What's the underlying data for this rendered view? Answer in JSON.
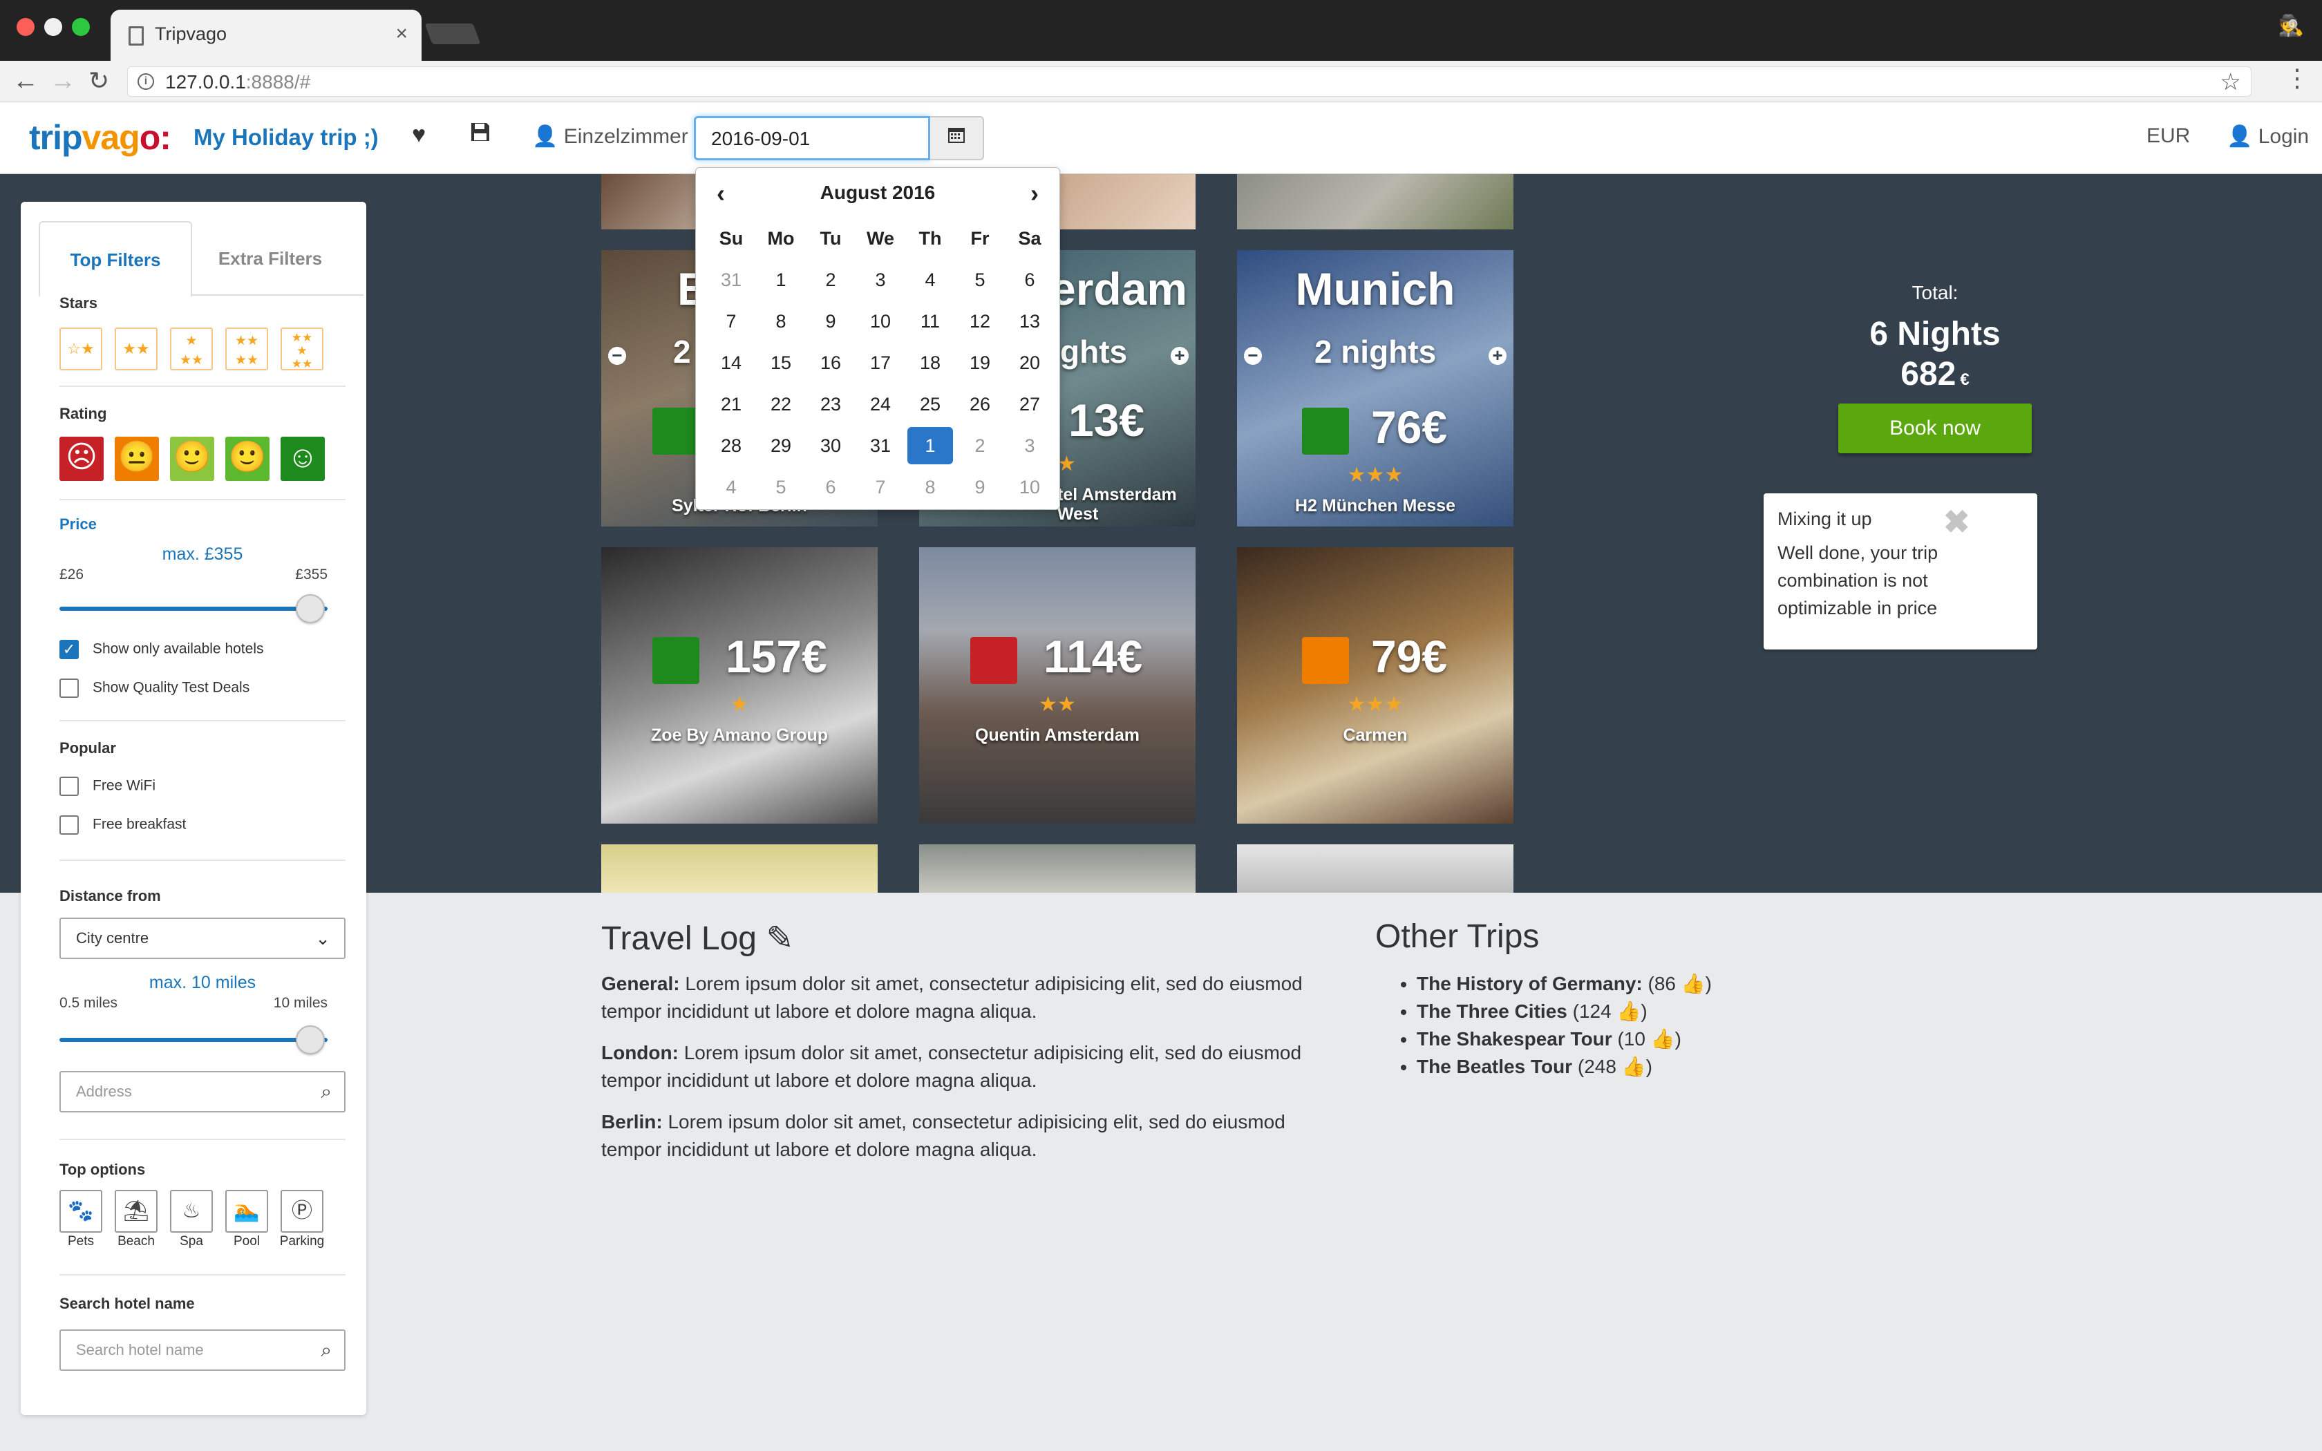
{
  "browser": {
    "tab_title": "Tripvago",
    "url_host": "127.0.0.1",
    "url_rest": ":8888/#"
  },
  "header": {
    "logo_part1": "trip",
    "logo_part2": "vag",
    "logo_part3": "o:",
    "trip_name": "My Holiday trip ;)",
    "room_type": "Einzelzimmer",
    "date_value": "2016-09-01",
    "currency": "EUR",
    "login": "Login"
  },
  "calendar": {
    "month_title": "August 2016",
    "weekdays": [
      "Su",
      "Mo",
      "Tu",
      "We",
      "Th",
      "Fr",
      "Sa"
    ],
    "weeks": [
      [
        "31",
        "1",
        "2",
        "3",
        "4",
        "5",
        "6"
      ],
      [
        "7",
        "8",
        "9",
        "10",
        "11",
        "12",
        "13"
      ],
      [
        "14",
        "15",
        "16",
        "17",
        "18",
        "19",
        "20"
      ],
      [
        "21",
        "22",
        "23",
        "24",
        "25",
        "26",
        "27"
      ],
      [
        "28",
        "29",
        "30",
        "31",
        "1",
        "2",
        "3"
      ],
      [
        "4",
        "5",
        "6",
        "7",
        "8",
        "9",
        "10"
      ]
    ],
    "selected_day": "1"
  },
  "sidebar": {
    "tab_top": "Top Filters",
    "tab_extra": "Extra Filters",
    "stars_label": "Stars",
    "rating_label": "Rating",
    "price_label": "Price",
    "price_max": "max. £355",
    "price_min_label": "£26",
    "price_max_label": "£355",
    "price_slider_value": 1.0,
    "show_available": "Show only available hotels",
    "show_quality": "Show Quality Test Deals",
    "popular_label": "Popular",
    "free_wifi": "Free WiFi",
    "free_breakfast": "Free breakfast",
    "distance_label": "Distance from",
    "distance_select": "City centre",
    "distance_max": "max. 10 miles",
    "distance_min_label": "0.5 miles",
    "distance_max_label": "10 miles",
    "distance_slider_value": 1.0,
    "address_placeholder": "Address",
    "top_options_label": "Top options",
    "options": [
      "Pets",
      "Beach",
      "Spa",
      "Pool",
      "Parking"
    ],
    "search_label": "Search hotel name",
    "search_placeholder": "Search hotel name"
  },
  "tiles": {
    "berlin_city": "B",
    "berlin_nights": "2",
    "berlin_name": "Sylter Hof Berlin",
    "amsterdam_city": "erdam",
    "amsterdam_nights": "ghts",
    "amsterdam_price": "13€",
    "amsterdam_name": "tel Amsterdam West",
    "munich_city": "Munich",
    "munich_nights": "2  nights",
    "munich_price": "76€",
    "munich_stars": "★★★",
    "munich_name": "H2 München Messe",
    "zoe_price": "157€",
    "zoe_stars": "★",
    "zoe_name": "Zoe By Amano Group",
    "quentin_price": "114€",
    "quentin_stars": "★★",
    "quentin_name": "Quentin Amsterdam",
    "carmen_price": "79€",
    "carmen_stars": "★★★",
    "carmen_name": "Carmen"
  },
  "summary": {
    "total_label": "Total:",
    "nights": "6 Nights",
    "price": "682",
    "currency_symbol": "€",
    "book_button": "Book now",
    "tip_title": "Mixing it up",
    "tip_body": "Well done, your trip combination is not optimizable in price"
  },
  "travel_log": {
    "title": "Travel Log",
    "entries": [
      {
        "label": "General:",
        "text": " Lorem ipsum dolor sit amet, consectetur adipisicing elit, sed do eiusmod tempor incididunt ut labore et dolore magna aliqua."
      },
      {
        "label": "London:",
        "text": " Lorem ipsum dolor sit amet, consectetur adipisicing elit, sed do eiusmod tempor incididunt ut labore et dolore magna aliqua."
      },
      {
        "label": "Berlin:",
        "text": " Lorem ipsum dolor sit amet, consectetur adipisicing elit, sed do eiusmod tempor incididunt ut labore et dolore magna aliqua."
      }
    ]
  },
  "other_trips": {
    "title": "Other Trips",
    "items": [
      {
        "name": "The History of Germany:",
        "count": " (86 "
      },
      {
        "name": "The Three Cities",
        "count": " (124 "
      },
      {
        "name": "The Shakespear Tour",
        "count": " (10 "
      },
      {
        "name": "The Beatles Tour",
        "count": " (248 "
      }
    ]
  },
  "colors": {
    "brand_blue": "#1b75bb",
    "dark_bg": "#34404b",
    "book_green": "#5ba80e",
    "rating": [
      "#c62127",
      "#ef7d00",
      "#8cc63f",
      "#5cb82e",
      "#1e8a1e"
    ]
  }
}
